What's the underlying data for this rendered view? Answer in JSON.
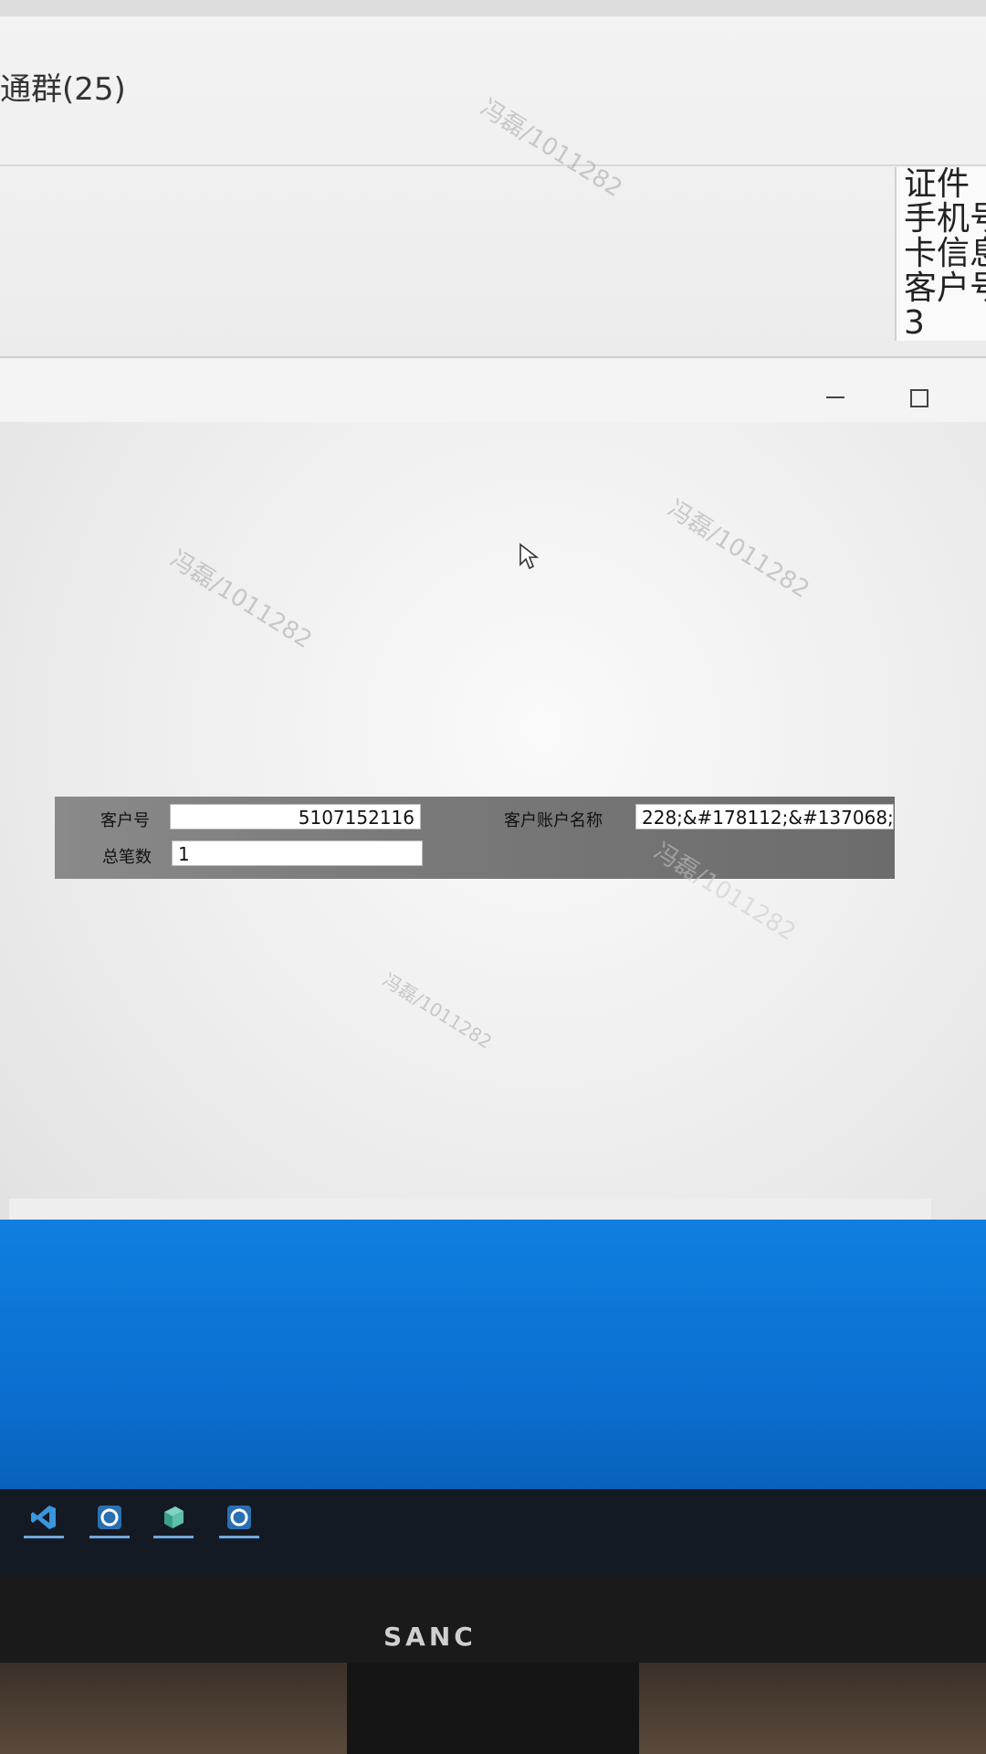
{
  "chat": {
    "group_title": "通群(25)",
    "side_lines": [
      "证件",
      "手机号",
      "卡信息",
      "客户号",
      "3"
    ]
  },
  "watermark_text": "冯磊/1011282",
  "dialog": {
    "fields": {
      "customer_no_label": "客户号",
      "customer_no_value": "5107152116",
      "total_count_label": "总笔数",
      "total_count_value": "1",
      "account_name_label": "客户账户名称",
      "account_name_value": "228;&#178112;&#137068;"
    }
  },
  "toolbar": {
    "icons": [
      "scan-icon",
      "zoom-in-icon",
      "zoom-out-icon",
      "rotate-left-icon",
      "rotate-right-icon",
      "fit-icon",
      "download-icon"
    ]
  },
  "monitor": {
    "brand": "SANC"
  }
}
